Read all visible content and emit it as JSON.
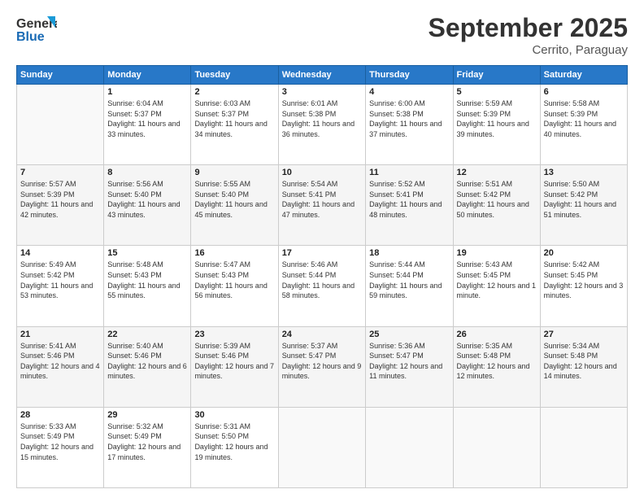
{
  "header": {
    "logo": {
      "line1": "General",
      "line2": "Blue"
    },
    "title": "September 2025",
    "subtitle": "Cerrito, Paraguay"
  },
  "days_of_week": [
    "Sunday",
    "Monday",
    "Tuesday",
    "Wednesday",
    "Thursday",
    "Friday",
    "Saturday"
  ],
  "weeks": [
    [
      {
        "day": "",
        "sunrise": "",
        "sunset": "",
        "daylight": ""
      },
      {
        "day": "1",
        "sunrise": "6:04 AM",
        "sunset": "5:37 PM",
        "daylight": "11 hours and 33 minutes."
      },
      {
        "day": "2",
        "sunrise": "6:03 AM",
        "sunset": "5:37 PM",
        "daylight": "11 hours and 34 minutes."
      },
      {
        "day": "3",
        "sunrise": "6:01 AM",
        "sunset": "5:38 PM",
        "daylight": "11 hours and 36 minutes."
      },
      {
        "day": "4",
        "sunrise": "6:00 AM",
        "sunset": "5:38 PM",
        "daylight": "11 hours and 37 minutes."
      },
      {
        "day": "5",
        "sunrise": "5:59 AM",
        "sunset": "5:39 PM",
        "daylight": "11 hours and 39 minutes."
      },
      {
        "day": "6",
        "sunrise": "5:58 AM",
        "sunset": "5:39 PM",
        "daylight": "11 hours and 40 minutes."
      }
    ],
    [
      {
        "day": "7",
        "sunrise": "5:57 AM",
        "sunset": "5:39 PM",
        "daylight": "11 hours and 42 minutes."
      },
      {
        "day": "8",
        "sunrise": "5:56 AM",
        "sunset": "5:40 PM",
        "daylight": "11 hours and 43 minutes."
      },
      {
        "day": "9",
        "sunrise": "5:55 AM",
        "sunset": "5:40 PM",
        "daylight": "11 hours and 45 minutes."
      },
      {
        "day": "10",
        "sunrise": "5:54 AM",
        "sunset": "5:41 PM",
        "daylight": "11 hours and 47 minutes."
      },
      {
        "day": "11",
        "sunrise": "5:52 AM",
        "sunset": "5:41 PM",
        "daylight": "11 hours and 48 minutes."
      },
      {
        "day": "12",
        "sunrise": "5:51 AM",
        "sunset": "5:42 PM",
        "daylight": "11 hours and 50 minutes."
      },
      {
        "day": "13",
        "sunrise": "5:50 AM",
        "sunset": "5:42 PM",
        "daylight": "11 hours and 51 minutes."
      }
    ],
    [
      {
        "day": "14",
        "sunrise": "5:49 AM",
        "sunset": "5:42 PM",
        "daylight": "11 hours and 53 minutes."
      },
      {
        "day": "15",
        "sunrise": "5:48 AM",
        "sunset": "5:43 PM",
        "daylight": "11 hours and 55 minutes."
      },
      {
        "day": "16",
        "sunrise": "5:47 AM",
        "sunset": "5:43 PM",
        "daylight": "11 hours and 56 minutes."
      },
      {
        "day": "17",
        "sunrise": "5:46 AM",
        "sunset": "5:44 PM",
        "daylight": "11 hours and 58 minutes."
      },
      {
        "day": "18",
        "sunrise": "5:44 AM",
        "sunset": "5:44 PM",
        "daylight": "11 hours and 59 minutes."
      },
      {
        "day": "19",
        "sunrise": "5:43 AM",
        "sunset": "5:45 PM",
        "daylight": "12 hours and 1 minute."
      },
      {
        "day": "20",
        "sunrise": "5:42 AM",
        "sunset": "5:45 PM",
        "daylight": "12 hours and 3 minutes."
      }
    ],
    [
      {
        "day": "21",
        "sunrise": "5:41 AM",
        "sunset": "5:46 PM",
        "daylight": "12 hours and 4 minutes."
      },
      {
        "day": "22",
        "sunrise": "5:40 AM",
        "sunset": "5:46 PM",
        "daylight": "12 hours and 6 minutes."
      },
      {
        "day": "23",
        "sunrise": "5:39 AM",
        "sunset": "5:46 PM",
        "daylight": "12 hours and 7 minutes."
      },
      {
        "day": "24",
        "sunrise": "5:37 AM",
        "sunset": "5:47 PM",
        "daylight": "12 hours and 9 minutes."
      },
      {
        "day": "25",
        "sunrise": "5:36 AM",
        "sunset": "5:47 PM",
        "daylight": "12 hours and 11 minutes."
      },
      {
        "day": "26",
        "sunrise": "5:35 AM",
        "sunset": "5:48 PM",
        "daylight": "12 hours and 12 minutes."
      },
      {
        "day": "27",
        "sunrise": "5:34 AM",
        "sunset": "5:48 PM",
        "daylight": "12 hours and 14 minutes."
      }
    ],
    [
      {
        "day": "28",
        "sunrise": "5:33 AM",
        "sunset": "5:49 PM",
        "daylight": "12 hours and 15 minutes."
      },
      {
        "day": "29",
        "sunrise": "5:32 AM",
        "sunset": "5:49 PM",
        "daylight": "12 hours and 17 minutes."
      },
      {
        "day": "30",
        "sunrise": "5:31 AM",
        "sunset": "5:50 PM",
        "daylight": "12 hours and 19 minutes."
      },
      {
        "day": "",
        "sunrise": "",
        "sunset": "",
        "daylight": ""
      },
      {
        "day": "",
        "sunrise": "",
        "sunset": "",
        "daylight": ""
      },
      {
        "day": "",
        "sunrise": "",
        "sunset": "",
        "daylight": ""
      },
      {
        "day": "",
        "sunrise": "",
        "sunset": "",
        "daylight": ""
      }
    ]
  ],
  "labels": {
    "sunrise_prefix": "Sunrise: ",
    "sunset_prefix": "Sunset: ",
    "daylight_prefix": "Daylight: "
  }
}
